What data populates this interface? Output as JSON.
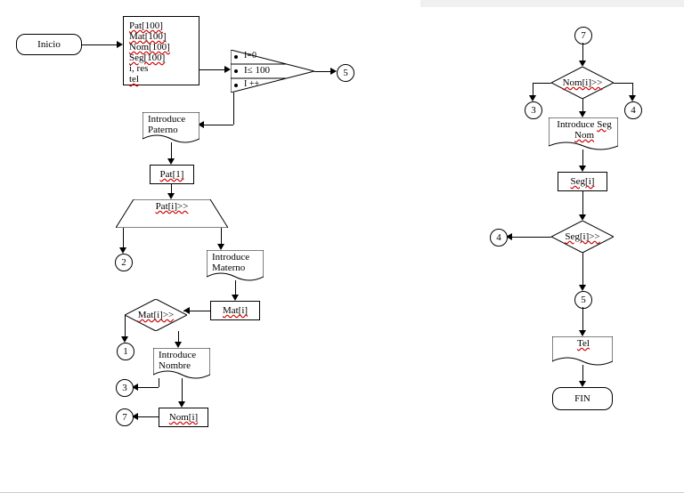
{
  "start": {
    "label": "Inicio"
  },
  "decl": {
    "lines": [
      "Pat[100]",
      "Mat[100]",
      "Nom[100]",
      "Seg[100]",
      "i, res",
      "tel"
    ]
  },
  "loop": {
    "init": "I=0",
    "cond": "I≤ 100",
    "step": "I ++",
    "exit_connector": "5"
  },
  "promptPaterno": {
    "label": "Introduce Paterno"
  },
  "pat1": {
    "label": "Pat[1]"
  },
  "patCond": {
    "label": "Pat[i]>>",
    "false_connector": "2"
  },
  "promptMaterno": {
    "label": "Introduce Materno"
  },
  "mat": {
    "label": "Mat[i]"
  },
  "matCond": {
    "label": "Mat[i]>>",
    "false_connector": "1"
  },
  "promptNombre": {
    "label": "Introduce Nombre",
    "connector": "3"
  },
  "nom": {
    "label": "Nom[i]",
    "connector": "7"
  },
  "page2_in": {
    "connector": "7"
  },
  "nomCond": {
    "label": "Nom[i]>>",
    "left_connector": "3",
    "right_connector": "4"
  },
  "promptSegNom": {
    "label": "Introduce Seg Nom"
  },
  "seg": {
    "label": "Seg[i]"
  },
  "segCond": {
    "label": "Seg[i]>>",
    "left_connector": "4"
  },
  "page2_out": {
    "connector": "5"
  },
  "tel": {
    "label": "Tel"
  },
  "fin": {
    "label": "FIN"
  }
}
